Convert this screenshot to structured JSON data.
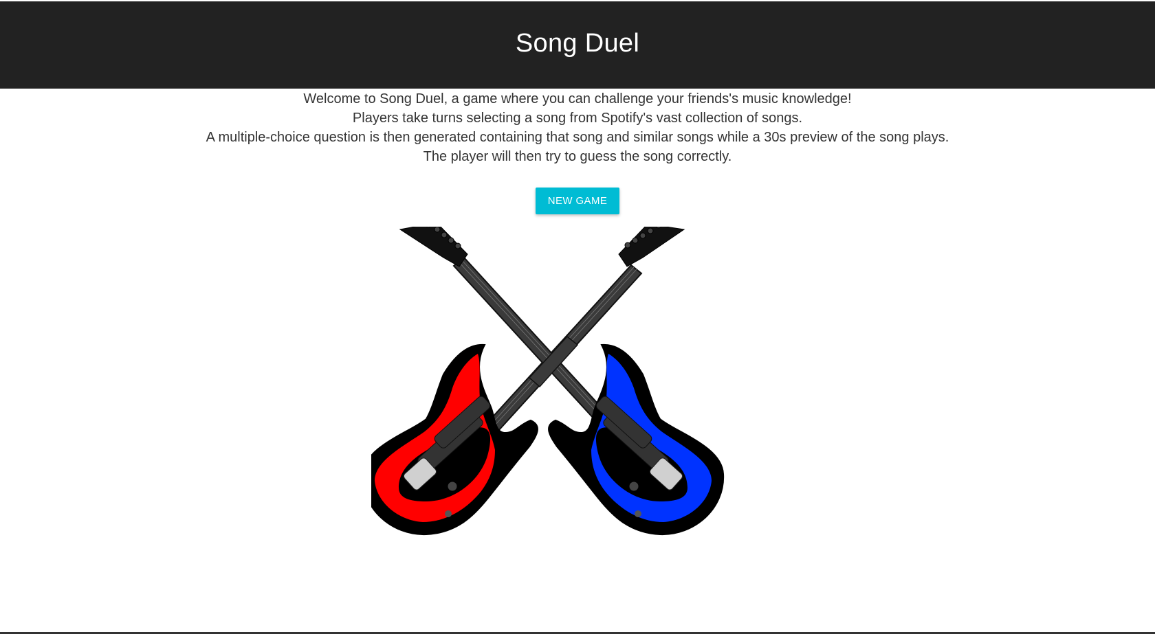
{
  "header": {
    "title": "Song Duel"
  },
  "intro": {
    "lines": [
      "Welcome to Song Duel, a game where you can challenge your friends's music knowledge!",
      "Players take turns selecting a song from Spotify's vast collection of songs.",
      "A multiple-choice question is then generated containing that song and similar songs while a 30s preview of the song plays.",
      "The player will then try to guess the song correctly."
    ]
  },
  "actions": {
    "new_game_label": "NEW GAME"
  },
  "colors": {
    "header_bg": "#222222",
    "accent": "#00bcd4",
    "guitar_left": "#ff0000",
    "guitar_right": "#0033ff"
  },
  "hero_image": {
    "description_icon": "crossed-guitars-image"
  }
}
